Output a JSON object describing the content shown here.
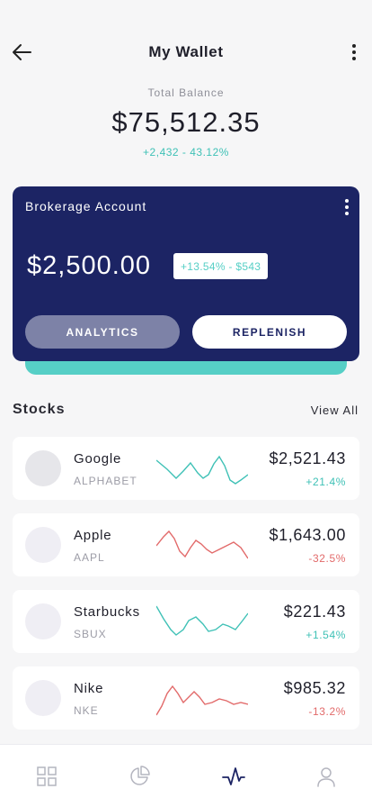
{
  "header": {
    "title": "My Wallet",
    "back_icon": "arrow-left-icon",
    "menu_icon": "more-vertical-icon"
  },
  "balance": {
    "label": "Total Balance",
    "value": "$75,512.35",
    "change": "+2,432 - 43.12%"
  },
  "card": {
    "title": "Brokerage Account",
    "amount": "$2,500.00",
    "badge": "+13.54% - $543",
    "analytics_label": "ANALYTICS",
    "replenish_label": "REPLENISH",
    "colors": {
      "card": "#1c2464",
      "accent": "#56cfc6"
    }
  },
  "stocks": {
    "title": "Stocks",
    "view_all": "View All",
    "items": [
      {
        "name": "Google",
        "ticker": "ALPHABET",
        "price": "$2,521.43",
        "change": "+21.4%",
        "trend": "up"
      },
      {
        "name": "Apple",
        "ticker": "AAPL",
        "price": "$1,643.00",
        "change": "-32.5%",
        "trend": "down"
      },
      {
        "name": "Starbucks",
        "ticker": "SBUX",
        "price": "$221.43",
        "change": "+1.54%",
        "trend": "up"
      },
      {
        "name": "Nike",
        "ticker": "NKE",
        "price": "$985.32",
        "change": "-13.2%",
        "trend": "down"
      }
    ],
    "colors": {
      "up": "#3fc1b6",
      "down": "#e26a6a"
    }
  },
  "tabbar": {
    "items": [
      {
        "icon": "grid-icon",
        "active": false
      },
      {
        "icon": "pie-chart-icon",
        "active": false
      },
      {
        "icon": "activity-icon",
        "active": true
      },
      {
        "icon": "user-icon",
        "active": false
      }
    ]
  }
}
